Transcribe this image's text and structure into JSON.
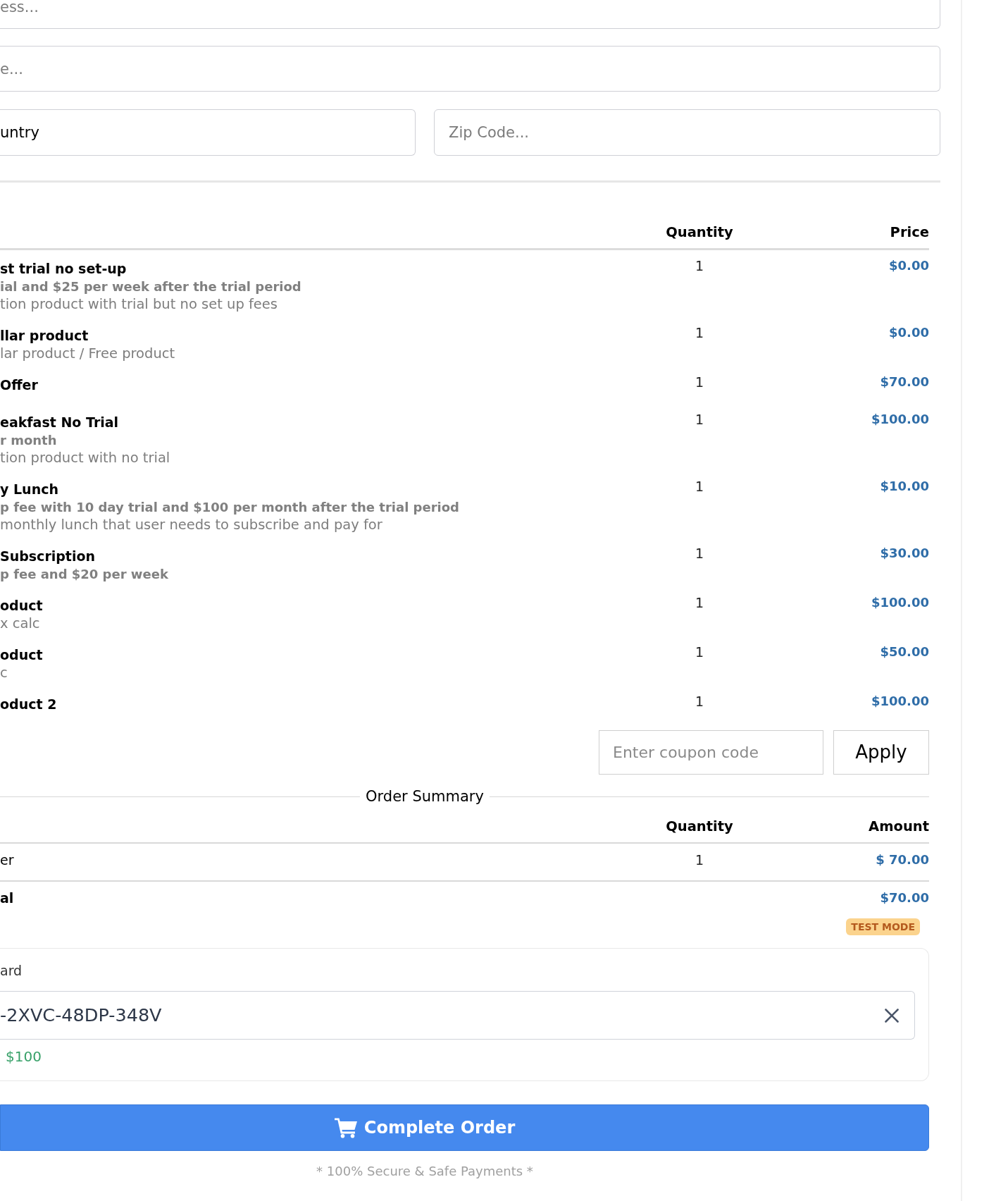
{
  "fields": [
    {
      "placeholder": "ess..."
    },
    {
      "placeholder": "e..."
    }
  ],
  "country_select": {
    "value": "untry"
  },
  "zip_field": {
    "placeholder": "Zip Code..."
  },
  "products": {
    "columns": [
      "Quantity",
      "Price"
    ],
    "rows": [
      {
        "name": "st trial no set-up",
        "terms": "ial and $25 per week after the trial period",
        "description": "tion product with trial but no set up fees",
        "quantity": "1",
        "price": "$0.00"
      },
      {
        "name": "llar product",
        "description": "lar product / Free product",
        "quantity": "1",
        "price": "$0.00"
      },
      {
        "name": "Offer",
        "quantity": "1",
        "price": "$70.00"
      },
      {
        "name": "eakfast No Trial",
        "terms": "r month",
        "description": "tion product with no trial",
        "quantity": "1",
        "price": "$100.00"
      },
      {
        "name": "y Lunch",
        "terms": "p fee with 10 day trial and $100 per month after the trial period",
        "description": "monthly lunch that user needs to subscribe and pay for",
        "quantity": "1",
        "price": "$10.00"
      },
      {
        "name": "Subscription",
        "terms": "p fee and $20 per week",
        "quantity": "1",
        "price": "$30.00"
      },
      {
        "name": "oduct",
        "description": "x calc",
        "quantity": "1",
        "price": "$100.00"
      },
      {
        "name": "oduct",
        "description": "c",
        "quantity": "1",
        "price": "$50.00"
      },
      {
        "name": "oduct 2",
        "quantity": "1",
        "price": "$100.00"
      }
    ]
  },
  "coupon": {
    "placeholder": "Enter coupon code",
    "button": "Apply"
  },
  "order_summary": {
    "title": "Order Summary",
    "columns": [
      "Quantity",
      "Amount"
    ],
    "rows": [
      {
        "name": "er",
        "quantity": "1",
        "amount": "$ 70.00"
      }
    ],
    "total": {
      "label": "al",
      "amount": "$70.00"
    },
    "badge": "TEST MODE"
  },
  "gift_card": {
    "label": "ard",
    "code": "-2XVC-48DP-348V",
    "balance": "$100"
  },
  "complete_button": "Complete Order",
  "footer_note": "* 100% Secure & Safe Payments *"
}
